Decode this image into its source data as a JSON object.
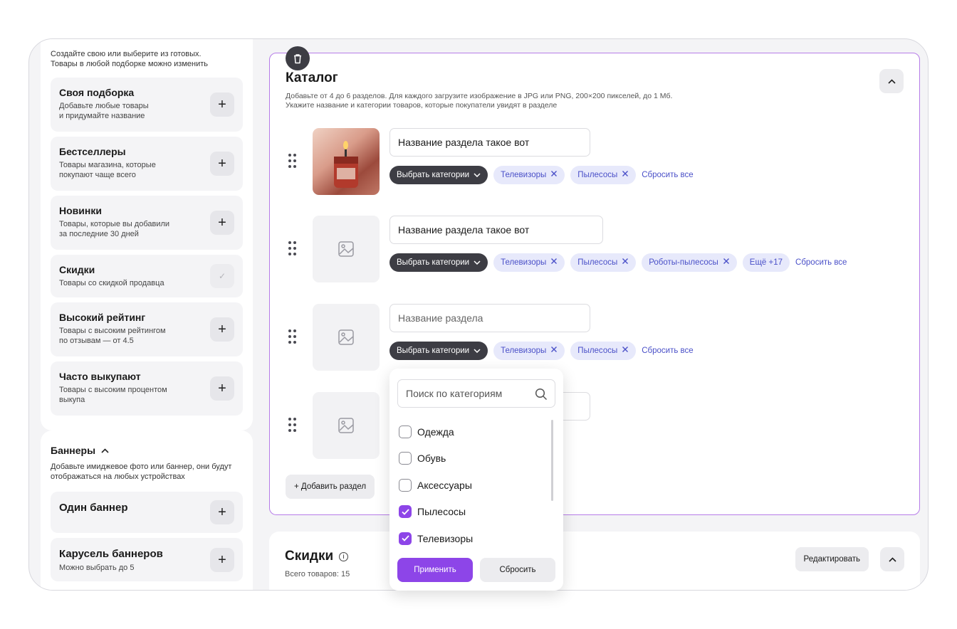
{
  "sidebar": {
    "intro": "Создайте свою или выберите из готовых.\nТовары в любой подборке можно изменить",
    "options": [
      {
        "title": "Своя подборка",
        "desc": "Добавьте любые товары\nи придумайте название",
        "state": "add"
      },
      {
        "title": "Бестселлеры",
        "desc": "Товары магазина, которые\nпокупают чаще всего",
        "state": "add"
      },
      {
        "title": "Новинки",
        "desc": "Товары, которые вы добавили\nза последние 30 дней",
        "state": "add"
      },
      {
        "title": "Скидки",
        "desc": "Товары со скидкой продавца",
        "state": "added"
      },
      {
        "title": "Высокий рейтинг",
        "desc": "Товары с высоким рейтингом\nпо отзывам — от 4.5",
        "state": "add"
      },
      {
        "title": "Часто выкупают",
        "desc": "Товары с высоким процентом\nвыкупа",
        "state": "add"
      }
    ],
    "banners": {
      "title": "Баннеры",
      "desc": "Добавьте имиджевое фото или баннер, они будут отображаться на любых устройствах",
      "options": [
        {
          "title": "Один баннер",
          "desc": ""
        },
        {
          "title": "Карусель баннеров",
          "desc": "Можно выбрать до 5"
        }
      ]
    },
    "plus_symbol": "+",
    "check_symbol": "✓"
  },
  "catalog": {
    "title": "Каталог",
    "desc": "Добавьте от 4 до 6 разделов. Для каждого загрузите изображение в JPG или PNG, 200×200 пикселей, до 1 Мб.\nУкажите название и категории товаров, которые покупатели увидят в разделе",
    "choose_label": "Выбрать категории",
    "reset_all": "Сбросить все",
    "sections": [
      {
        "name": "Название раздела такое вот",
        "placeholder": false,
        "has_photo": true,
        "chips": [
          "Телевизоры",
          "Пылесосы"
        ],
        "more": ""
      },
      {
        "name": "Название раздела такое вот",
        "placeholder": false,
        "has_photo": false,
        "chips": [
          "Телевизоры",
          "Пылесосы",
          "Роботы-пылесосы"
        ],
        "more": "Ещё +17"
      },
      {
        "name": "Название раздела",
        "placeholder": true,
        "has_photo": false,
        "chips": [
          "Телевизоры",
          "Пылесосы"
        ],
        "more": ""
      },
      {
        "name": "",
        "placeholder": true,
        "has_photo": false,
        "chips": [],
        "more": ""
      }
    ],
    "add_section": "+ Добавить раздел"
  },
  "discounts": {
    "title": "Скидки",
    "subtitle": "Всего товаров: 15",
    "edit": "Редактировать"
  },
  "dropdown": {
    "search_placeholder": "Поиск по категориям",
    "options": [
      {
        "label": "Одежда",
        "checked": false
      },
      {
        "label": "Обувь",
        "checked": false
      },
      {
        "label": "Аксессуары",
        "checked": false
      },
      {
        "label": "Пылесосы",
        "checked": true
      },
      {
        "label": "Телевизоры",
        "checked": true
      }
    ],
    "apply": "Применить",
    "reset": "Сбросить"
  },
  "colors": {
    "accent": "#8d45e8",
    "chip_bg": "#e7e9fb",
    "chip_text": "#4a50c8",
    "dark_chip": "#3d3d44"
  }
}
